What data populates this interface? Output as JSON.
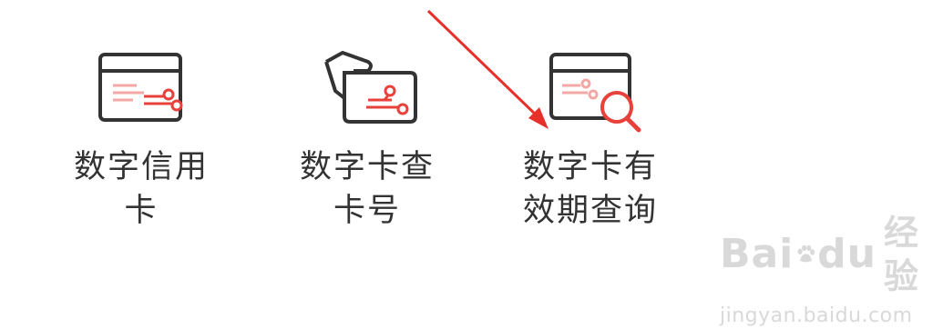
{
  "tiles": [
    {
      "label": "数字信用卡",
      "icon": "digital-credit-card-icon"
    },
    {
      "label": "数字卡查卡号",
      "icon": "card-number-lookup-icon"
    },
    {
      "label": "数字卡有效期查询",
      "icon": "card-expiry-search-icon"
    }
  ],
  "watermark": {
    "logo_text_1": "Bai",
    "logo_text_2": "du",
    "logo_text_3": "经验",
    "url": "jingyan.baidu.com"
  },
  "colors": {
    "icon_dark": "#333333",
    "icon_accent": "#e8413c",
    "icon_accent_light": "#f3a8a5",
    "annotation_arrow": "#e8302a",
    "label_text": "#333333",
    "watermark": "#d9d9d9"
  }
}
